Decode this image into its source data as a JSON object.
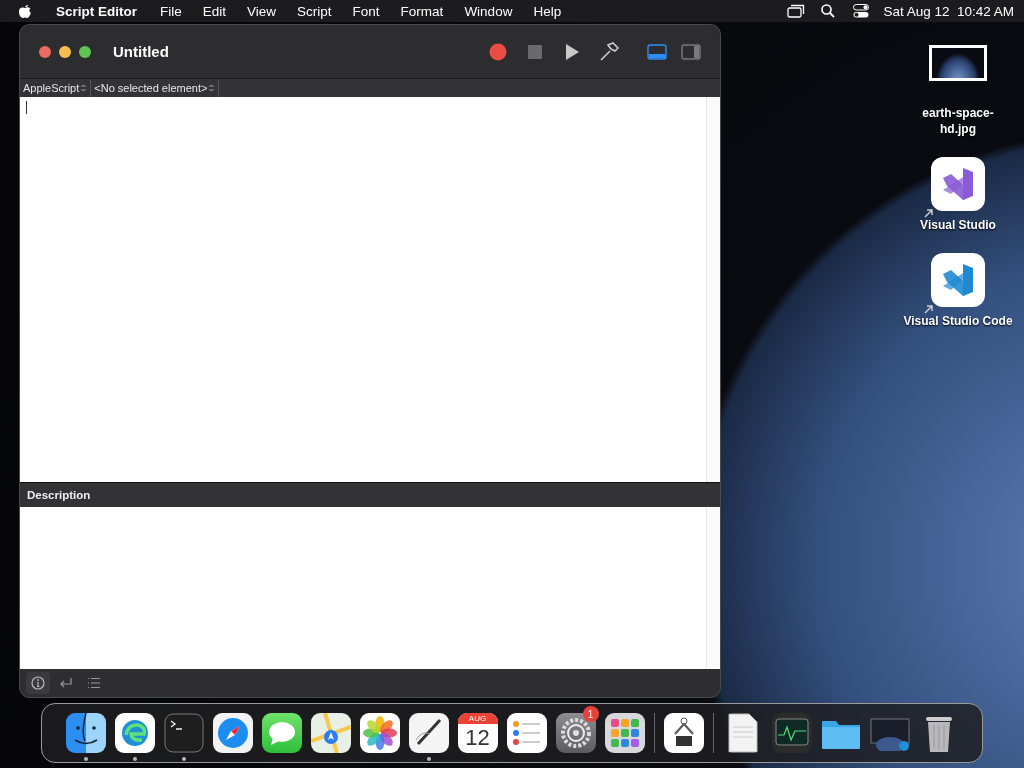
{
  "menu_bar": {
    "app_name": "Script Editor",
    "items": [
      "File",
      "Edit",
      "View",
      "Script",
      "Font",
      "Format",
      "Window",
      "Help"
    ],
    "clock": "Sat Aug 12  10:42 AM"
  },
  "window": {
    "title": "Untitled",
    "toolbar": [
      {
        "kind": "record",
        "disabled": false
      },
      {
        "kind": "stop",
        "disabled": true
      },
      {
        "kind": "run",
        "disabled": false
      },
      {
        "kind": "compile",
        "disabled": false
      }
    ],
    "layout_buttons": [
      {
        "kind": "bottom-pane",
        "selected": true
      },
      {
        "kind": "side-pane",
        "selected": false
      }
    ],
    "navigation": {
      "language": "AppleScript",
      "element": "<No selected element>"
    },
    "description_pane": {
      "title": "Description"
    },
    "bottom_tabs": [
      {
        "kind": "info",
        "selected": true
      },
      {
        "kind": "return",
        "selected": false
      },
      {
        "kind": "list",
        "selected": false
      }
    ]
  },
  "desktop_icons": [
    {
      "kind": "photo",
      "label": "earth-space-hd.jpg",
      "alias": false
    },
    {
      "kind": "purple-ribbon",
      "label": "Visual Studio",
      "alias": true
    },
    {
      "kind": "blue-ribbon",
      "label": "Visual Studio Code",
      "alias": true
    }
  ],
  "dock": {
    "items": [
      {
        "kind": "face",
        "running": true
      },
      {
        "kind": "swirl",
        "running": true
      },
      {
        "kind": "terminal",
        "running": true
      },
      {
        "kind": "compass",
        "running": false
      },
      {
        "kind": "speech-bubble",
        "running": false
      },
      {
        "kind": "map",
        "running": false
      },
      {
        "kind": "flower",
        "running": false
      },
      {
        "kind": "pen",
        "running": true
      },
      {
        "kind": "calendar",
        "running": false,
        "month": "AUG",
        "day": "12"
      },
      {
        "kind": "checklist",
        "running": false
      },
      {
        "kind": "gear",
        "running": false,
        "badge": "1"
      },
      {
        "kind": "app-grid",
        "running": false
      },
      {
        "kind": "separator"
      },
      {
        "kind": "hardware",
        "running": false
      },
      {
        "kind": "separator"
      },
      {
        "kind": "document",
        "running": false
      },
      {
        "kind": "monitor",
        "running": false
      },
      {
        "kind": "folder",
        "running": false
      },
      {
        "kind": "screenshot",
        "running": false
      },
      {
        "kind": "trash",
        "running": false
      }
    ]
  }
}
